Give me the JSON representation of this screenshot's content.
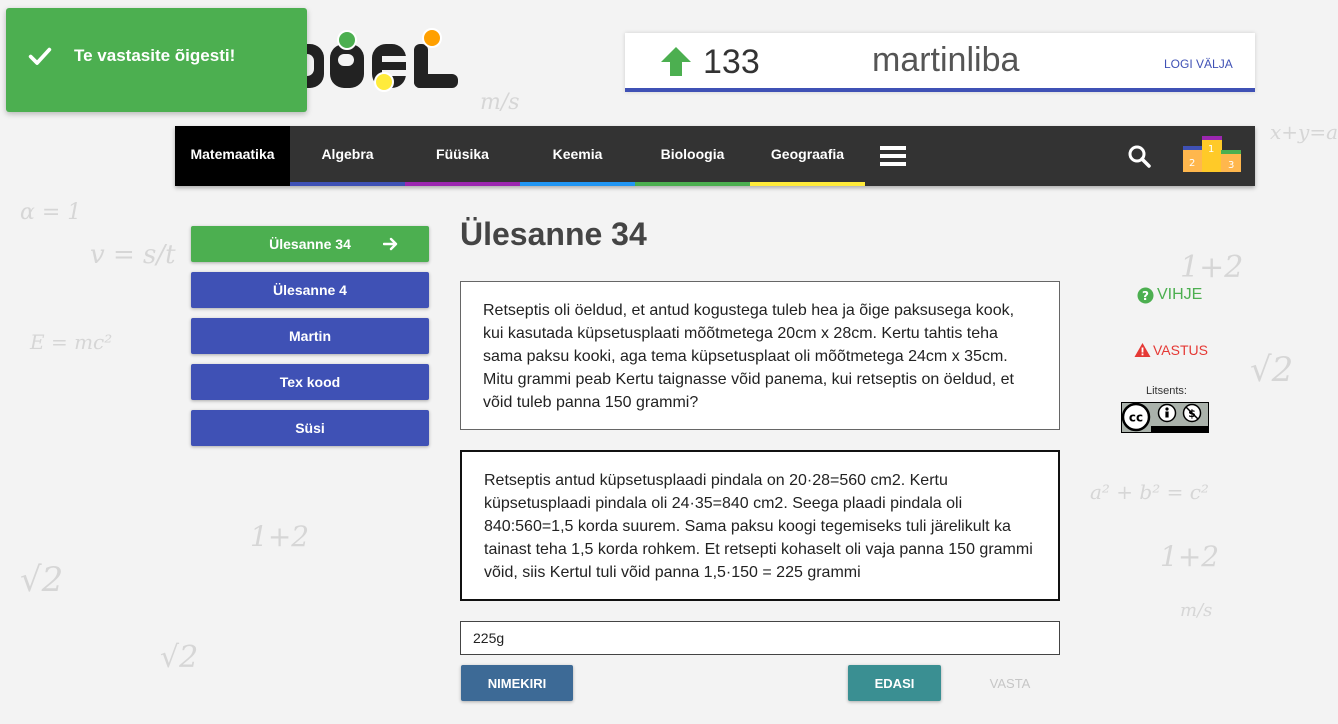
{
  "toast": {
    "message": "Te vastasite õigesti!"
  },
  "user": {
    "score": "133",
    "username": "martinliba",
    "logout": "LOGI VÄLJA"
  },
  "nav": {
    "items": [
      {
        "label": "Matemaatika",
        "color": "#000000"
      },
      {
        "label": "Algebra",
        "color": "#3f51b5"
      },
      {
        "label": "Füüsika",
        "color": "#9c27b0"
      },
      {
        "label": "Keemia",
        "color": "#2196f3"
      },
      {
        "label": "Bioloogia",
        "color": "#4caf50"
      },
      {
        "label": "Geograafia",
        "color": "#ffeb3b"
      }
    ],
    "menu_icon": "hamburger-icon",
    "search_icon": "search-icon",
    "podium_icon": "podium-icon"
  },
  "sidebar": {
    "items": [
      {
        "label": "Ülesanne 34"
      },
      {
        "label": "Ülesanne 4"
      },
      {
        "label": "Martin"
      },
      {
        "label": "Tex kood"
      },
      {
        "label": "Süsi"
      }
    ]
  },
  "main": {
    "title": "Ülesanne 34",
    "question": "Retseptis oli öeldud, et antud kogustega tuleb hea ja õige paksusega kook, kui kasutada küpsetusplaati mõõtmetega 20cm x 28cm. Kertu tahtis teha sama paksu kooki, aga tema küpsetusplaat oli mõõtmetega 24cm x 35cm. Mitu grammi peab Kertu taignasse võid panema, kui retseptis on öeldud, et võid tuleb panna 150 grammi?",
    "solution": "Retseptis antud küpsetusplaadi pindala on 20·28=560 cm2. Kertu küpsetusplaadi pindala oli 24·35=840 cm2. Seega plaadi pindala oli 840:560=1,5 korda suurem. Sama paksu koogi tegemiseks tuli järelikult ka tainast teha 1,5 korda rohkem. Et retsepti kohaselt oli vaja panna 150 grammi võid, siis Kertul tuli võid panna 1,5·150 = 225 grammi",
    "answer_value": "225g",
    "buttons": {
      "list": "NIMEKIRI",
      "next": "EDASI",
      "submit": "VASTA"
    }
  },
  "aside": {
    "hint": "VIHJE",
    "answer": "VASTUS",
    "license_label": "Litsents:"
  },
  "colors": {
    "accent": "#3f51b5",
    "success": "#4caf50",
    "danger": "#e53935",
    "nav_bg": "#333333"
  }
}
